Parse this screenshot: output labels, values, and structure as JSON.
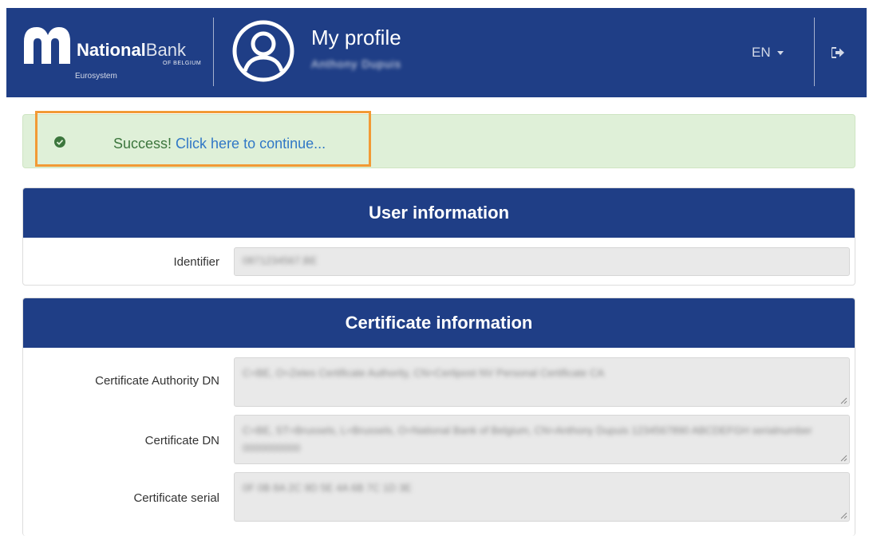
{
  "header": {
    "brand_bold": "National",
    "brand_light": "Bank",
    "brand_sub": "OF BELGIUM",
    "brand_euro": "Eurosystem",
    "title": "My profile",
    "user_name": "Anthony Dupuis",
    "language": "EN",
    "colors": {
      "background": "#1f3e86"
    }
  },
  "alert": {
    "prefix": "Success!",
    "link": "Click here to continue...",
    "colors": {
      "background": "#dff0d8",
      "text": "#3c763d",
      "link": "#3178c6",
      "highlight": "#f29a35"
    }
  },
  "user_info": {
    "title": "User information",
    "identifier_label": "Identifier",
    "identifier_value": "0871234567.BE"
  },
  "cert_info": {
    "title": "Certificate information",
    "authority_label": "Certificate Authority DN",
    "authority_value": "C=BE, O=Zetes Certificate Authority, CN=Certipost NV Personal Certificate CA",
    "dn_label": "Certificate DN",
    "dn_value": "C=BE, ST=Brussels, L=Brussels, O=National Bank of Belgium, CN=Anthony Dupuis 1234567890 ABCDEFGH serialnumber 0000000000",
    "serial_label": "Certificate serial",
    "serial_value": "0F 0B 8A 2C 9D 5E 4A 6B 7C 1D 3E"
  }
}
